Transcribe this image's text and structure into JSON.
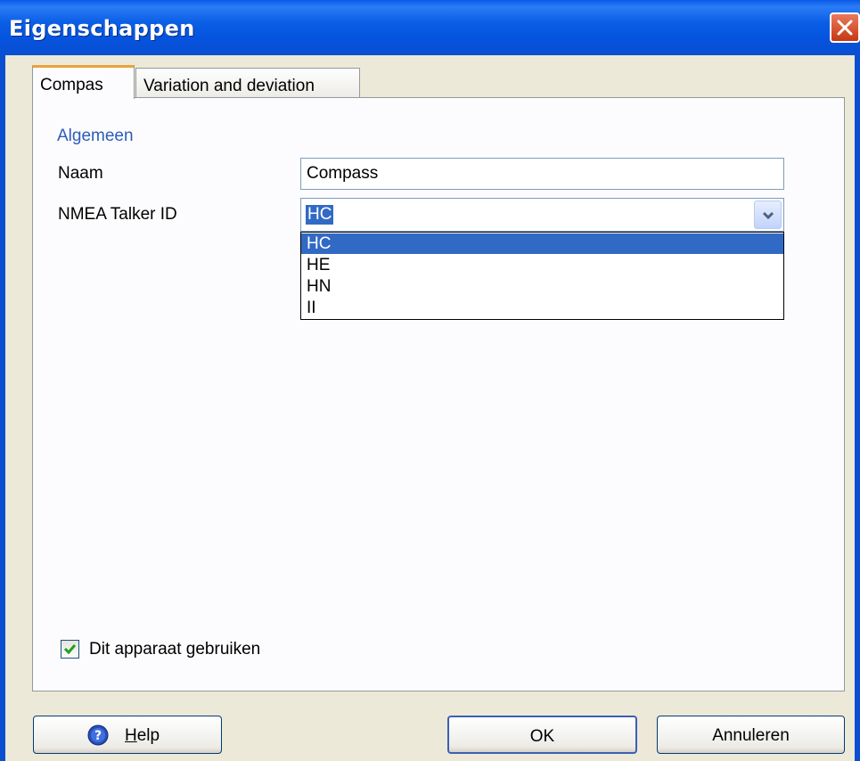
{
  "window": {
    "title": "Eigenschappen"
  },
  "tabs": [
    {
      "label": "Compas",
      "active": true
    },
    {
      "label": "Variation and deviation",
      "active": false
    }
  ],
  "group": {
    "title": "Algemeen"
  },
  "fields": {
    "naam_label": "Naam",
    "naam_value": "Compass",
    "nmea_label": "NMEA Talker ID",
    "nmea_value": "HC",
    "nmea_options": [
      "HC",
      "HE",
      "HN",
      "II"
    ],
    "nmea_selected_index": 0
  },
  "checkbox": {
    "label": "Dit apparaat gebruiken",
    "checked": true
  },
  "buttons": {
    "help_first": "H",
    "help_rest": "elp",
    "ok": "OK",
    "cancel": "Annuleren"
  },
  "colors": {
    "title_bar": "#0553de",
    "selection": "#316ac5",
    "group_title": "#2b5db8",
    "close_button": "#d5502c"
  },
  "icons": {
    "close": "close-icon",
    "dropdown": "chevron-down-icon",
    "check": "checkmark-icon",
    "help": "help-icon"
  }
}
